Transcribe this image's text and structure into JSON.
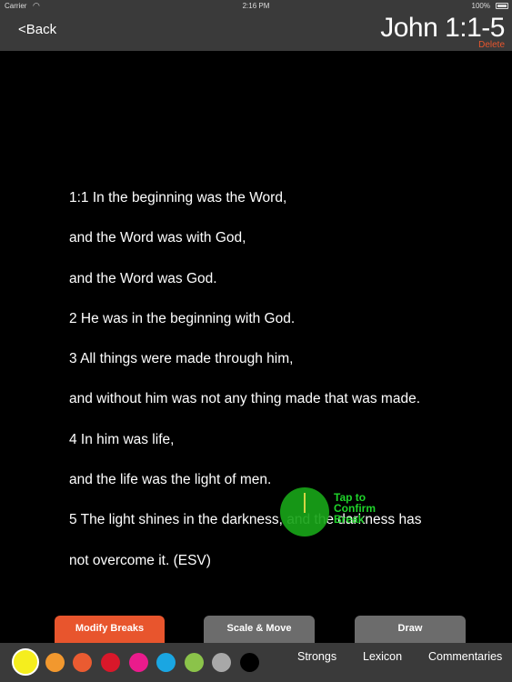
{
  "status_bar": {
    "carrier": "Carrier",
    "wifi_icon": "wifi-icon",
    "time": "2:16 PM",
    "battery": "100%",
    "battery_icon": "battery-icon"
  },
  "nav": {
    "back_label": "<Back",
    "title": "John 1:1-5",
    "delete_label": "Delete"
  },
  "verses": [
    "1:1 In the beginning was the Word,",
    "and the Word was with God,",
    "and the Word was God.",
    "2 He was in the beginning with God.",
    "3 All things were made through him,",
    "and without him was not any thing made that was made.",
    "4 In him was life,",
    "and the life was the light of men.",
    "5 The light shines in the darkness, and the darkness has",
    "not overcome it.  (ESV)"
  ],
  "confirm_break": {
    "label_lines": [
      "Tap to",
      "Confirm",
      "Break"
    ]
  },
  "tabs": {
    "modify_breaks": "Modify Breaks",
    "scale_move": "Scale & Move",
    "draw": "Draw",
    "active": "modify_breaks",
    "active_color": "#e8552d"
  },
  "colors": [
    {
      "name": "yellow",
      "hex": "#f5ee1e",
      "selected": true
    },
    {
      "name": "orange",
      "hex": "#f2982e",
      "selected": false
    },
    {
      "name": "red-orange",
      "hex": "#ea5b31",
      "selected": false
    },
    {
      "name": "red",
      "hex": "#d9182a",
      "selected": false
    },
    {
      "name": "magenta",
      "hex": "#ea1b8c",
      "selected": false
    },
    {
      "name": "sky-blue",
      "hex": "#1aa6e2",
      "selected": false
    },
    {
      "name": "green",
      "hex": "#8bc34a",
      "selected": false
    },
    {
      "name": "gray",
      "hex": "#a8a8a8",
      "selected": false
    },
    {
      "name": "black",
      "hex": "#000000",
      "selected": false
    }
  ],
  "toolbar": {
    "strongs": "Strongs",
    "lexicon": "Lexicon",
    "commentaries": "Commentaries"
  }
}
